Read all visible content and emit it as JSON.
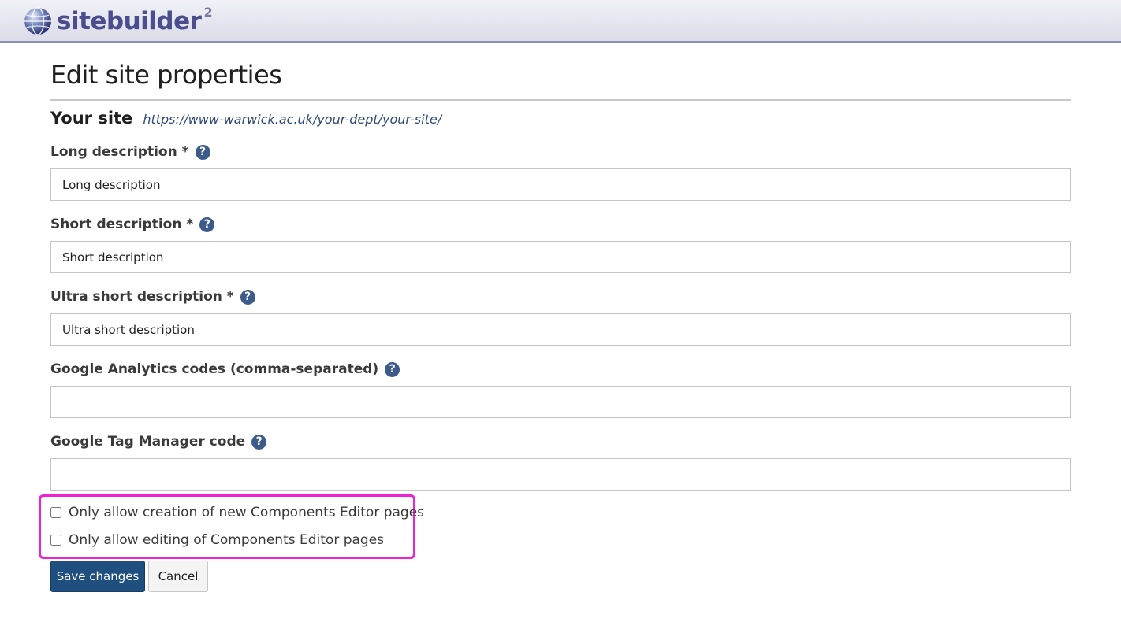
{
  "app": {
    "name": "sitebuilder",
    "version_sup": "2"
  },
  "page": {
    "title": "Edit site properties"
  },
  "site": {
    "label": "Your site",
    "url": "https://www-warwick.ac.uk/your-dept/your-site/"
  },
  "fields": {
    "long_description": {
      "label": "Long description *",
      "value": "Long description"
    },
    "short_description": {
      "label": "Short description *",
      "value": "Short description"
    },
    "ultra_short_description": {
      "label": "Ultra short description *",
      "value": "Ultra short description"
    },
    "google_analytics": {
      "label": "Google Analytics codes (comma-separated)",
      "value": ""
    },
    "google_tag_manager": {
      "label": "Google Tag Manager code",
      "value": ""
    }
  },
  "help_icon_glyph": "?",
  "checkboxes": {
    "creation": {
      "label": "Only allow creation of new Components Editor pages",
      "checked": false
    },
    "editing": {
      "label": "Only allow editing of Components Editor pages",
      "checked": false
    }
  },
  "buttons": {
    "save": "Save changes",
    "cancel": "Cancel"
  },
  "colors": {
    "highlight": "#f01fd8",
    "primary_button": "#1f4f7e",
    "help_icon": "#3c5a8a",
    "link": "#2f4a78"
  }
}
